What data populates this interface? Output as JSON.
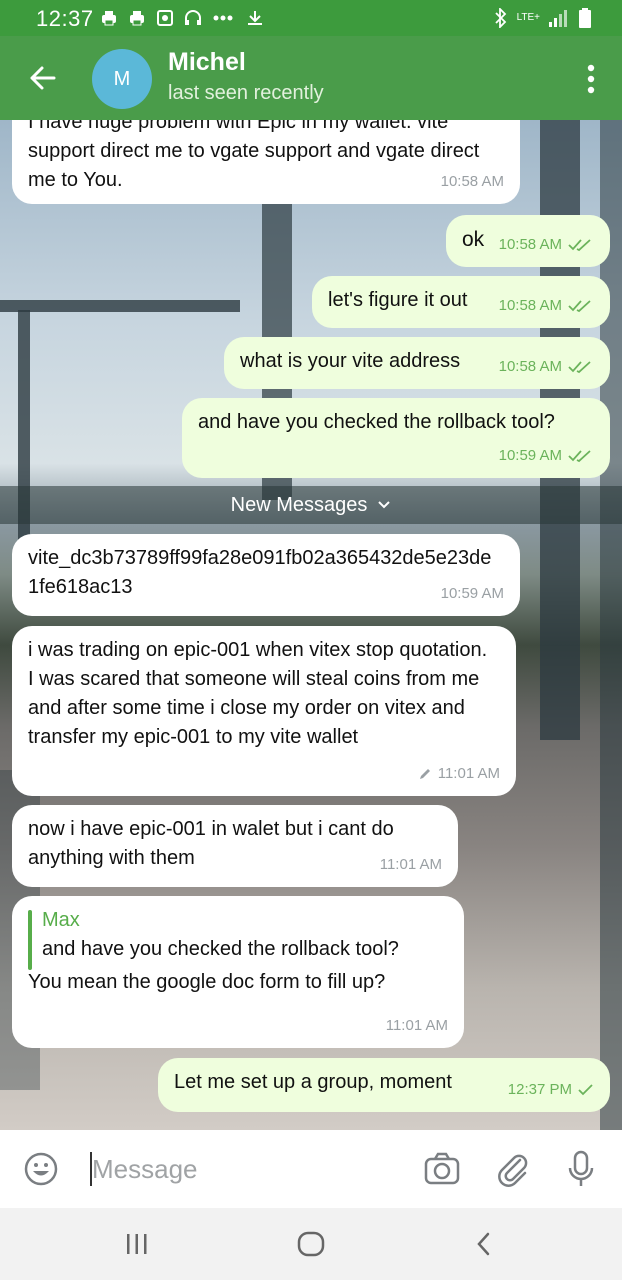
{
  "status_bar": {
    "time": "12:37",
    "network": "LTE+"
  },
  "header": {
    "contact_name": "Michel",
    "contact_status": "last seen recently",
    "avatar_initial": "M"
  },
  "messages": [
    {
      "text": "I have huge problem with Epic in my wallet. vite support direct me to vgate support and vgate direct me to You.",
      "time": "10:58 AM"
    },
    {
      "text": "ok",
      "time": "10:58 AM"
    },
    {
      "text": "let's figure it out",
      "time": "10:58 AM"
    },
    {
      "text": "what is your vite address",
      "time": "10:58 AM"
    },
    {
      "text": "and have you checked the rollback tool?",
      "time": "10:59 AM"
    },
    {
      "text": "vite_dc3b73789ff99fa28e091fb02a365432de5e23de1fe618ac13",
      "time": "10:59 AM"
    },
    {
      "text": "i was trading on epic-001 when vitex stop quotation. I was scared that someone will steal coins from me and after some time i close my order on vitex and transfer my epic-001 to my vite wallet",
      "time": "11:01 AM"
    },
    {
      "text": "now i have epic-001 in walet but i cant do anything with them",
      "time": "11:01 AM"
    },
    {
      "reply_name": "Max",
      "reply_text": "and have you checked the rollback tool?",
      "text": "You mean the google doc form to fill up?",
      "time": "11:01 AM"
    },
    {
      "text": "Let me set up a group, moment",
      "time": "12:37 PM"
    }
  ],
  "new_messages_label": "New Messages",
  "input": {
    "placeholder": "Message"
  },
  "colors": {
    "header": "#4a9c4a",
    "status_bar": "#3d9b3d",
    "outgoing_bubble": "#effedd",
    "incoming_bubble": "#ffffff",
    "accent": "#57ad4a",
    "avatar": "#5bb8d8"
  }
}
